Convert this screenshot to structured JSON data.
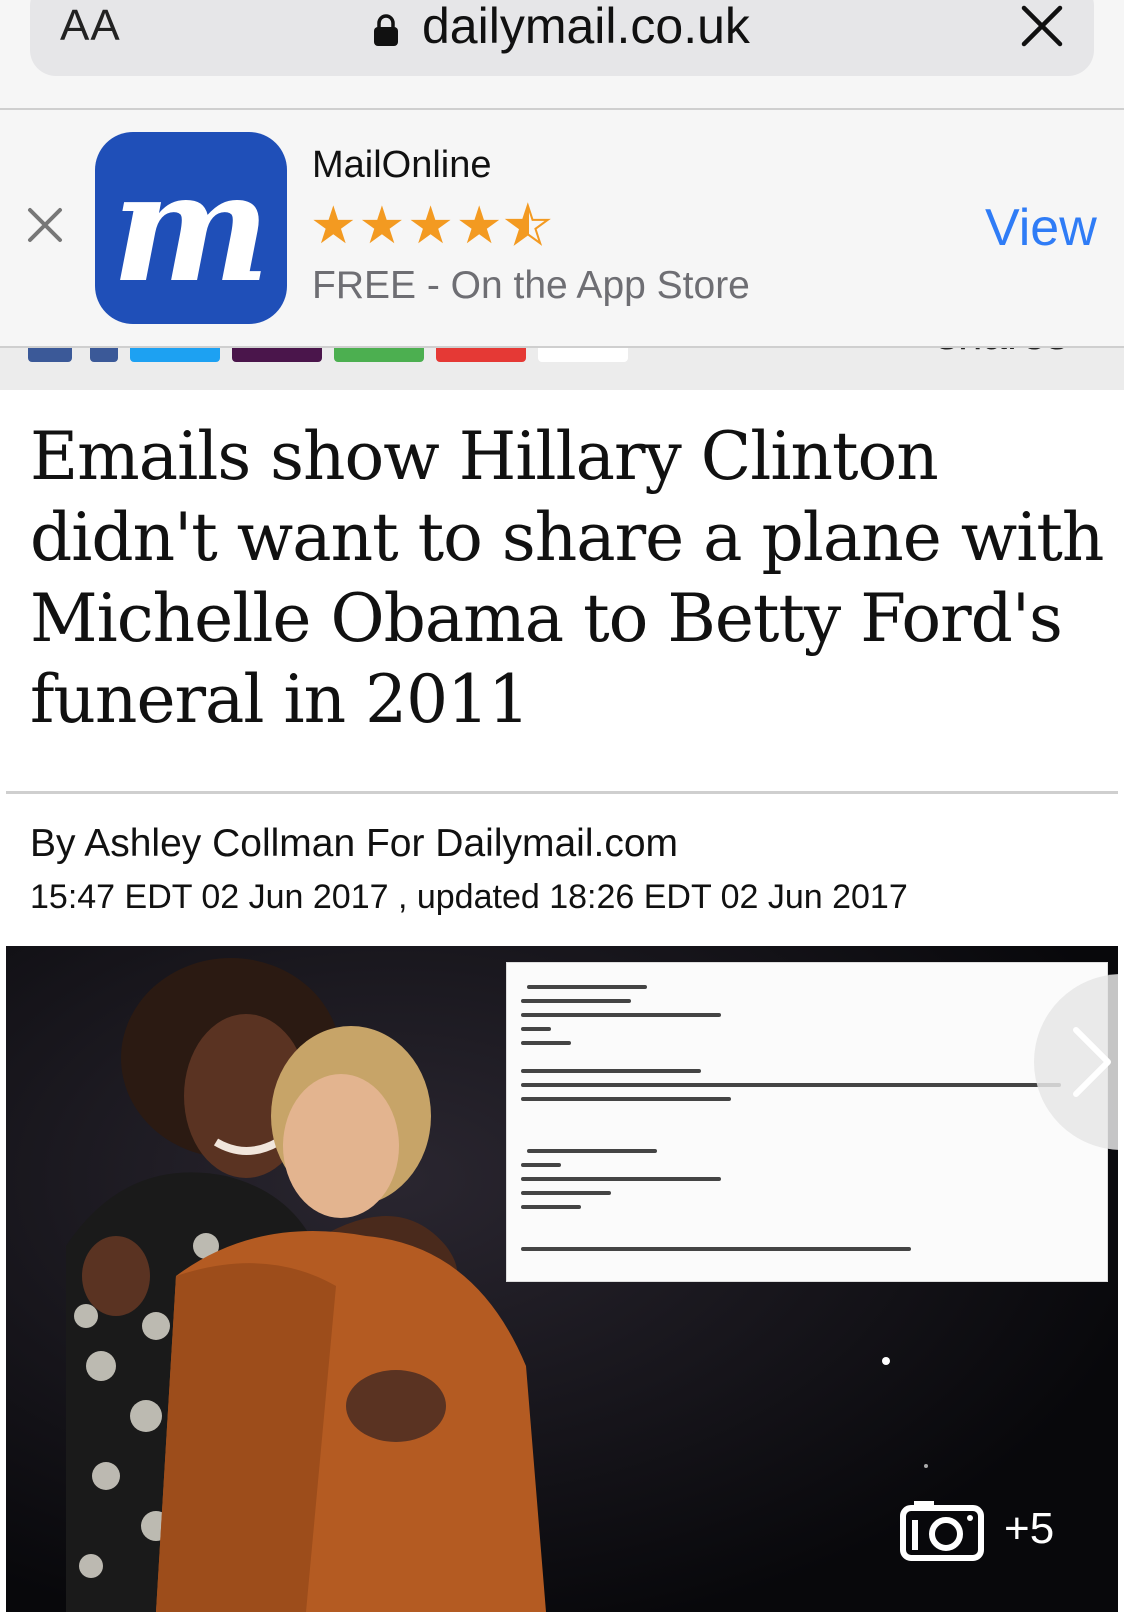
{
  "browser": {
    "text_size_label": "AA",
    "url": "dailymail.co.uk"
  },
  "app_banner": {
    "app_name": "MailOnline",
    "rating_stars": 4.5,
    "store_text": "FREE - On the App Store",
    "view_label": "View",
    "icon_letter": "m",
    "brand_color": "#1f4fb8"
  },
  "share_bar": {
    "shares_label": "shares",
    "colors": [
      "#3b5998",
      "#3b5998",
      "#1da1f2",
      "#4a154b",
      "#4caf50",
      "#e53935",
      "#ffffff"
    ]
  },
  "article": {
    "headline": "Emails show Hillary Clinton didn't want to share a plane with Michelle Obama to Betty Ford's funeral in 2011",
    "byline": "By Ashley Collman For Dailymail.com",
    "dateline": "15:47 EDT 02 Jun 2017 , updated 18:26 EDT 02 Jun 2017"
  },
  "hero_image": {
    "gallery_count": "+5"
  },
  "icons": [
    "lock-icon",
    "close-icon",
    "star-icon",
    "chevron-right-icon",
    "camera-icon"
  ]
}
